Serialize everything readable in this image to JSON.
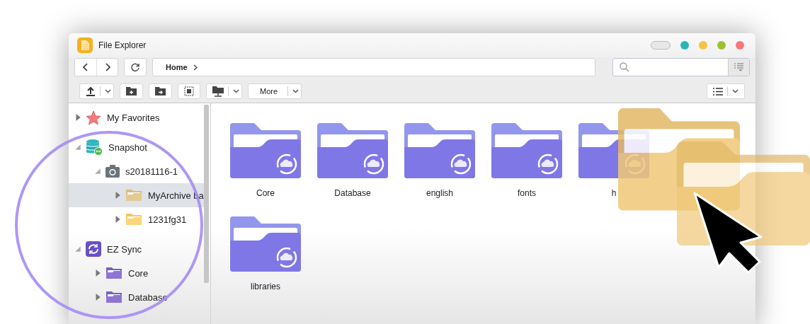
{
  "window": {
    "title": "File Explorer",
    "controls": [
      {
        "kind": "pill"
      },
      {
        "kind": "dot",
        "color": "#2bb5b8"
      },
      {
        "kind": "dot",
        "color": "#f6c444"
      },
      {
        "kind": "dot",
        "color": "#9bc231"
      },
      {
        "kind": "dot",
        "color": "#f87878"
      }
    ]
  },
  "navigation": {
    "breadcrumb": [
      {
        "label": "Home"
      }
    ]
  },
  "toolbar": {
    "buttons": [
      {
        "kind": "upload",
        "dropdown": true
      },
      {
        "kind": "new-folder",
        "dropdown": false
      },
      {
        "kind": "move",
        "dropdown": false
      },
      {
        "kind": "select",
        "dropdown": false
      },
      {
        "kind": "share",
        "dropdown": true
      },
      {
        "kind": "text",
        "label": "More",
        "dropdown": true
      }
    ]
  },
  "sidebar": {
    "tree": [
      {
        "label": "My Favorites",
        "kind": "favorites",
        "expanded": false,
        "selected": false
      },
      {
        "label": "Snapshot",
        "kind": "snapshot",
        "expanded": true,
        "selected": false,
        "children": [
          {
            "label": "s20181116-1",
            "kind": "camera",
            "expanded": true,
            "selected": false,
            "children": [
              {
                "label": "MyArchive ba",
                "kind": "folder",
                "expanded": false,
                "selected": true
              },
              {
                "label": "1231fg31",
                "kind": "folder",
                "expanded": false,
                "selected": false
              }
            ]
          }
        ]
      },
      {
        "label": "EZ Sync",
        "kind": "sync",
        "expanded": true,
        "selected": false,
        "children": [
          {
            "label": "Core",
            "kind": "sync-folder",
            "expanded": false,
            "selected": false
          },
          {
            "label": "Database",
            "kind": "sync-folder",
            "expanded": false,
            "selected": false
          }
        ]
      }
    ]
  },
  "files": [
    {
      "label": "Core"
    },
    {
      "label": "Database"
    },
    {
      "label": "english"
    },
    {
      "label": "fonts"
    },
    {
      "label": "h"
    },
    {
      "label": "libraries"
    }
  ]
}
